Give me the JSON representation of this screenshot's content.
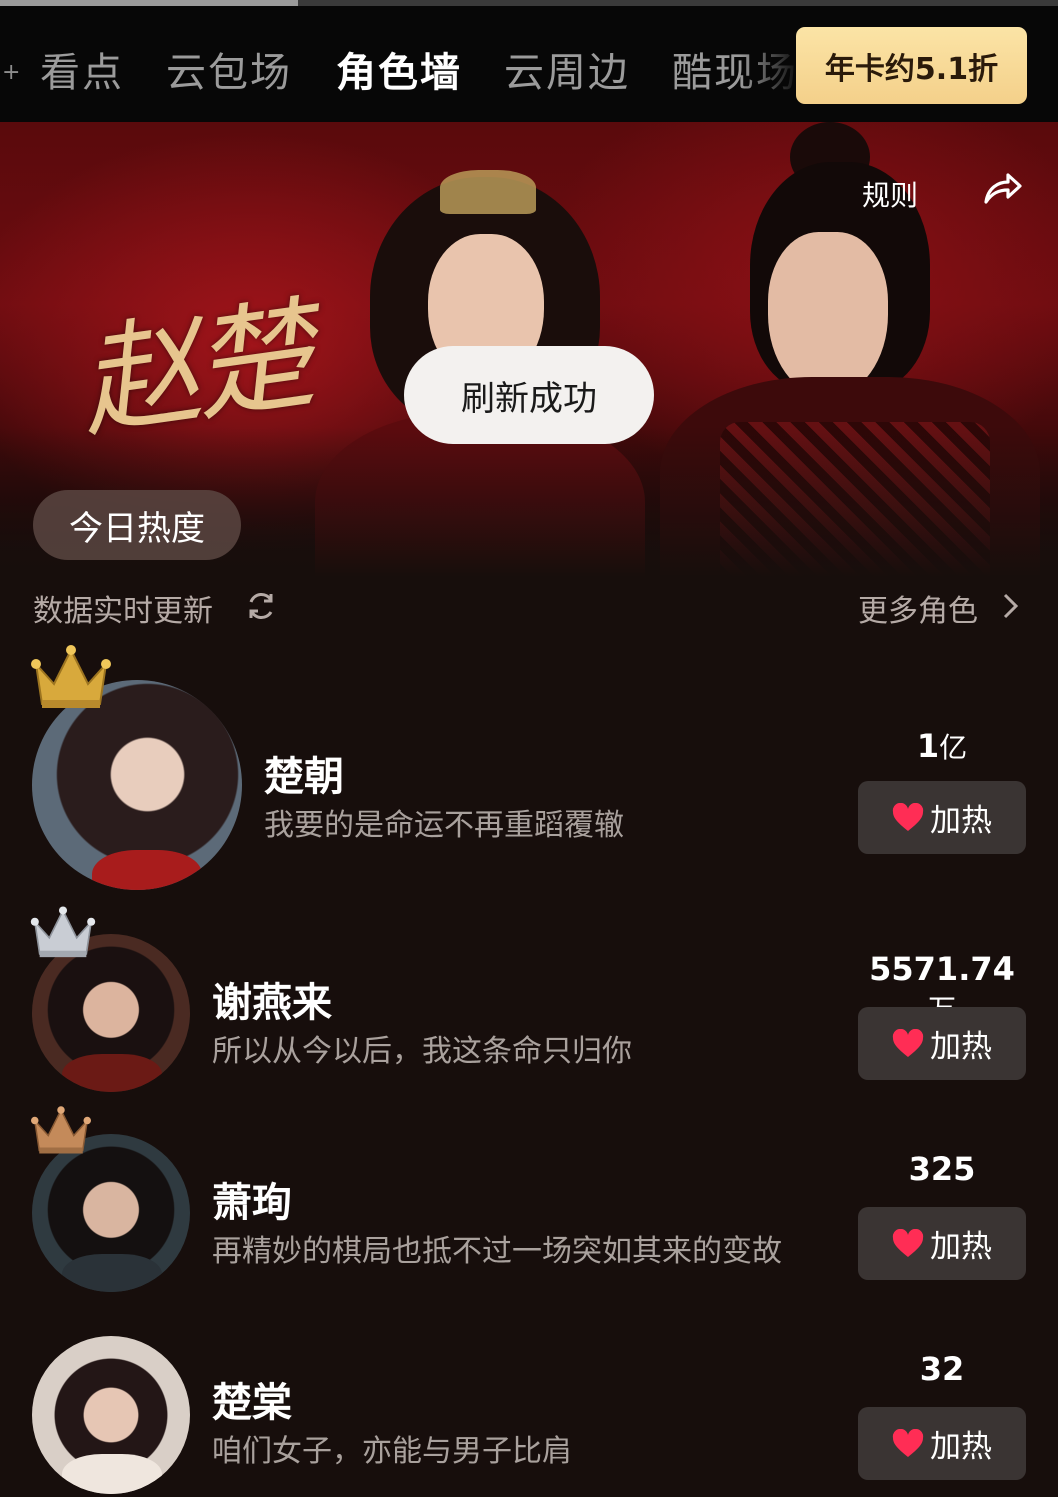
{
  "tabs": [
    {
      "label": "看点",
      "active": false
    },
    {
      "label": "云包场",
      "active": false
    },
    {
      "label": "角色墙",
      "active": true
    },
    {
      "label": "云周边",
      "active": false
    },
    {
      "label": "酷现场",
      "active": false
    }
  ],
  "promo": {
    "label": "年卡约5.1折"
  },
  "banner": {
    "title_art": "赵楚",
    "rules_label": "规则",
    "share_icon": "share-icon",
    "toast": "刷新成功",
    "today_heat_label": "今日热度"
  },
  "list_header": {
    "realtime_label": "数据实时更新",
    "more_roles_label": "更多角色"
  },
  "colors": {
    "background": "#170e0c",
    "promo": "#f4d08a",
    "heart": "#ff2d55",
    "crown_gold": "#d8a93c",
    "crown_silver": "#c9cdd4",
    "crown_bronze": "#c48a5a"
  },
  "characters": [
    {
      "rank": 1,
      "crown": "gold",
      "name": "楚朝",
      "quote": "我要的是命运不再重蹈覆辙",
      "heat_value": "1",
      "heat_unit": "亿",
      "boost_label": "加热"
    },
    {
      "rank": 2,
      "crown": "silver",
      "name": "谢燕来",
      "quote": "所以从今以后，我这条命只归你",
      "heat_value": "5571.74",
      "heat_unit": "万",
      "boost_label": "加热"
    },
    {
      "rank": 3,
      "crown": "bronze",
      "name": "萧珣",
      "quote": "再精妙的棋局也抵不过一场突如其来的变故",
      "heat_value": "325",
      "heat_unit": "",
      "boost_label": "加热"
    },
    {
      "rank": 4,
      "crown": "none",
      "name": "楚棠",
      "quote": "咱们女子，亦能与男子比肩",
      "heat_value": "32",
      "heat_unit": "",
      "boost_label": "加热"
    }
  ]
}
